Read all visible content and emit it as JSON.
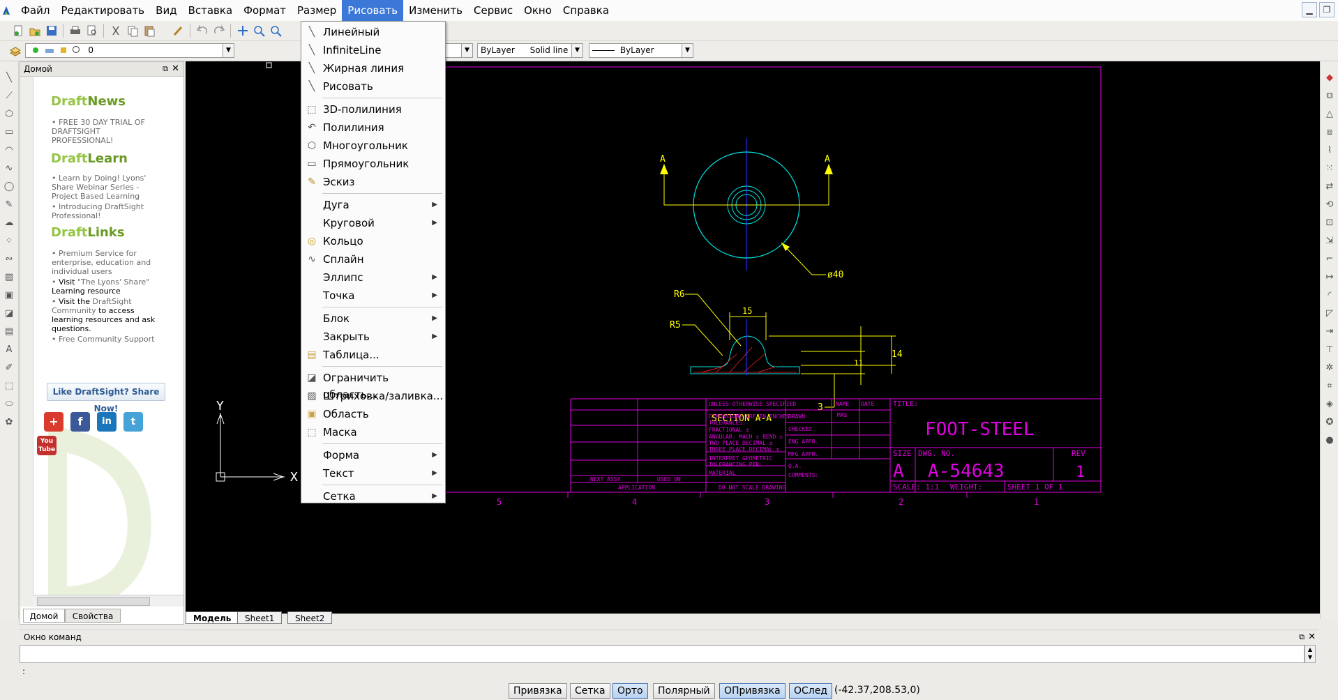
{
  "menubar": {
    "items": [
      "Файл",
      "Редактировать",
      "Вид",
      "Вставка",
      "Формат",
      "Размер",
      "Рисовать",
      "Изменить",
      "Сервис",
      "Окно",
      "Справка"
    ],
    "active": "Рисовать"
  },
  "toolbar2": {
    "layer_value": "0",
    "linetype_color": "ByLayer",
    "linetype_name": "Solid line",
    "lineweight": "ByLayer"
  },
  "palette": {
    "title": "Домой",
    "news": {
      "pre": "Draft",
      "post": "News",
      "items": [
        "FREE 30 DAY TRIAL OF DRAFTSIGHT PROFESSIONAL!"
      ]
    },
    "learn": {
      "pre": "Draft",
      "post": "Learn",
      "items": [
        "Learn by Doing! Lyons' Share Webinar Series - Project Based Learning",
        "Introducing DraftSight Professional!"
      ]
    },
    "links": {
      "pre": "Draft",
      "post": "Links",
      "items": [
        {
          "a": "Premium Service for enterprise, education and individual users",
          "b": ""
        },
        {
          "a": "Visit ",
          "b": "\"The Lyons' Share\"",
          "c": " Learning resource"
        },
        {
          "a": "Visit the ",
          "b": "DraftSight Community",
          "c": " to access learning resources and ask questions."
        },
        {
          "a": "Free Community Support",
          "b": ""
        }
      ]
    },
    "like_button": "Like DraftSight? Share Now!",
    "tabs": [
      "Домой",
      "Свойства"
    ]
  },
  "draw_menu": {
    "groups": [
      [
        {
          "label": "Линейный",
          "icon": "line-icon"
        },
        {
          "label": "InfiniteLine",
          "icon": "infinite-line-icon"
        },
        {
          "label": "Жирная линия",
          "icon": "bold-line-icon"
        },
        {
          "label": "Рисовать",
          "icon": "sketch-line-icon"
        }
      ],
      [
        {
          "label": "3D-полилиния",
          "icon": "3d-polyline-icon"
        },
        {
          "label": "Полилиния",
          "icon": "polyline-icon"
        },
        {
          "label": "Многоугольник",
          "icon": "polygon-icon"
        },
        {
          "label": "Прямоугольник",
          "icon": "rectangle-icon"
        },
        {
          "label": "Эскиз",
          "icon": "sketch-icon"
        }
      ],
      [
        {
          "label": "Дуга",
          "sub": true
        },
        {
          "label": "Круговой",
          "sub": true
        },
        {
          "label": "Кольцо",
          "icon": "donut-icon"
        },
        {
          "label": "Сплайн",
          "icon": "spline-icon"
        },
        {
          "label": "Эллипс",
          "sub": true
        },
        {
          "label": "Точка",
          "sub": true
        }
      ],
      [
        {
          "label": "Блок",
          "sub": true
        },
        {
          "label": "Закрыть",
          "sub": true
        },
        {
          "label": "Таблица...",
          "icon": "table-icon"
        }
      ],
      [
        {
          "label": "Ограничить область...",
          "icon": "boundary-icon"
        },
        {
          "label": "Штриховка/заливка...",
          "icon": "hatch-icon"
        },
        {
          "label": "Область",
          "icon": "region-icon"
        },
        {
          "label": "Маска",
          "icon": "mask-icon"
        }
      ],
      [
        {
          "label": "Форма",
          "sub": true
        },
        {
          "label": "Текст",
          "sub": true
        }
      ],
      [
        {
          "label": "Сетка",
          "sub": true
        }
      ]
    ]
  },
  "drawing": {
    "section_marks": [
      "A",
      "A"
    ],
    "diameter": "ø40",
    "dims": {
      "r6": "R6",
      "r5": "R5",
      "w15": "15",
      "h11": "11",
      "h14": "14",
      "t3": "3"
    },
    "section_title": "SECTION A-A",
    "axis_y": "Y",
    "axis_x": "X",
    "zones": [
      "5",
      "4",
      "3",
      "2",
      "1"
    ],
    "title_block": {
      "unless": "UNLESS OTHERWISE SPECIFIED",
      "name_hdr": "NAME",
      "date_hdr": "DATE",
      "title_hdr": "TITLE:",
      "title": "FOOT-STEEL",
      "drawn": "DRAWN",
      "drawn_by": "MAS",
      "checked": "CHECKED",
      "eng": "ENG APPR.",
      "mfg": "MFG APPR.",
      "qa": "Q.A.",
      "comments": "COMMENTS:",
      "tol1": "DIMENSIONS ARE IN INCHES",
      "tol2": "TOLERANCES:",
      "tol3": "FRACTIONAL ±",
      "tol4": "ANGULAR: MACH ±   BEND ±",
      "tol5": "TWO PLACE DECIMAL  ±",
      "tol6": "THREE PLACE DECIMAL  ±",
      "interp1": "INTERPRET GEOMETRIC",
      "interp2": "TOLERANCING PER:",
      "material": "MATERIAL",
      "next_assy": "NEXT ASSY",
      "used_on": "USED ON",
      "application": "APPLICATION",
      "noscale": "DO NOT SCALE DRAWING",
      "size_hdr": "SIZE",
      "size": "A",
      "dwg_hdr": "DWG.  NO.",
      "dwg_no": "A-54643",
      "rev_hdr": "REV",
      "rev": "1",
      "scale": "SCALE: 1:1",
      "weight": "WEIGHT:",
      "sheet": "SHEET 1 OF 1"
    }
  },
  "layout_tabs": [
    "Модель",
    "Sheet1",
    "Sheet2"
  ],
  "command": {
    "title": "Окно команд",
    "prompt": ":"
  },
  "status": {
    "buttons": [
      {
        "label": "Привязка",
        "on": false
      },
      {
        "label": "Сетка",
        "on": false
      },
      {
        "label": "Орто",
        "on": true
      },
      {
        "label": "Полярный",
        "on": false
      },
      {
        "label": "ОПривязка",
        "on": true
      },
      {
        "label": "ОСлед",
        "on": true
      }
    ],
    "coords": "(-42.37,208.53,0)"
  },
  "colors": {
    "accent": "#3b78d8",
    "cad_magenta": "#e000e0",
    "cad_yellow": "#ffff00",
    "cad_cyan": "#00e5e5",
    "cad_blue": "#2a2aff",
    "cad_red": "#ff2020"
  }
}
